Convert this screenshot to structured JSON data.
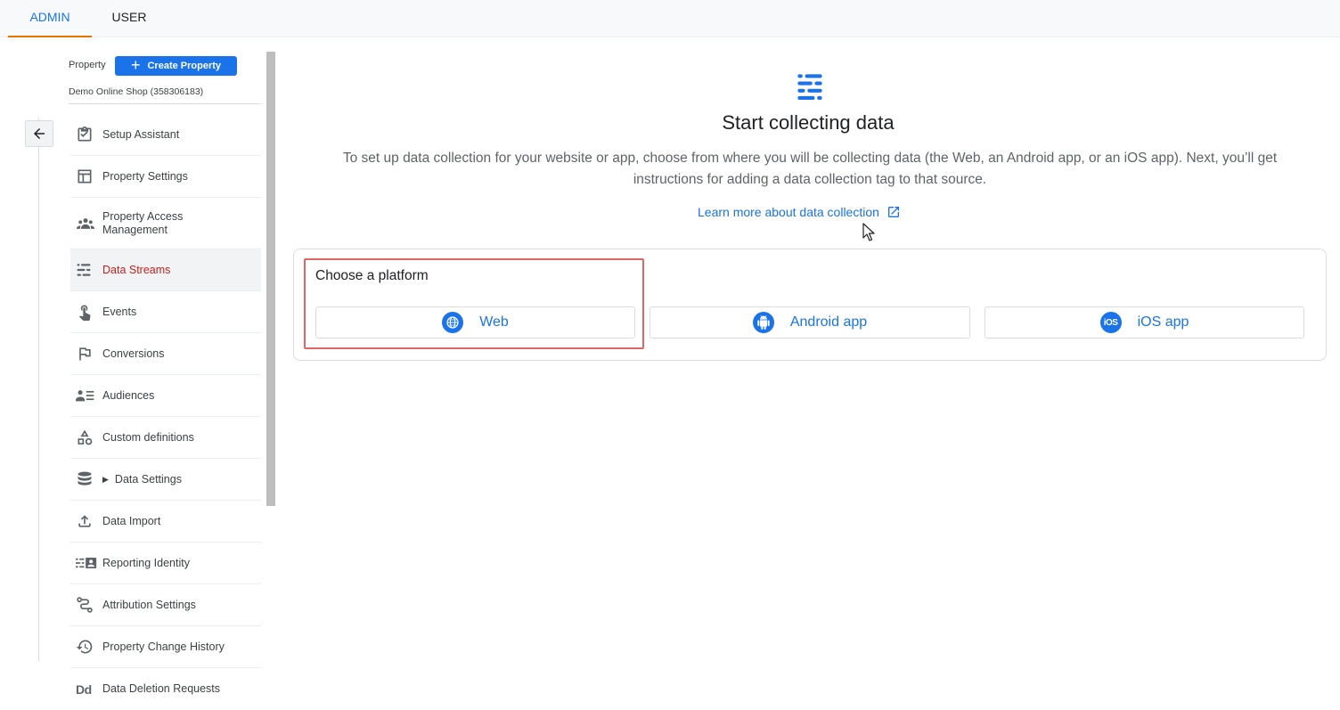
{
  "tabs": [
    {
      "label": "ADMIN",
      "active": true
    },
    {
      "label": "USER",
      "active": false
    }
  ],
  "property": {
    "label": "Property",
    "create_button": "Create Property",
    "name": "Demo Online Shop (358306183)"
  },
  "nav": {
    "items": [
      {
        "label": "Setup Assistant",
        "icon": "clipboard-check-icon"
      },
      {
        "label": "Property Settings",
        "icon": "layout-icon"
      },
      {
        "label": "Property Access Management",
        "icon": "people-icon"
      },
      {
        "label": "Data Streams",
        "icon": "data-streams-icon",
        "active": true
      },
      {
        "label": "Events",
        "icon": "touch-icon"
      },
      {
        "label": "Conversions",
        "icon": "flag-icon"
      },
      {
        "label": "Audiences",
        "icon": "audience-icon"
      },
      {
        "label": "Custom definitions",
        "icon": "shapes-icon"
      },
      {
        "label": "Data Settings",
        "icon": "database-icon",
        "expandable": true
      },
      {
        "label": "Data Import",
        "icon": "upload-icon"
      },
      {
        "label": "Reporting Identity",
        "icon": "reporting-identity-icon"
      },
      {
        "label": "Attribution Settings",
        "icon": "attribution-icon"
      },
      {
        "label": "Property Change History",
        "icon": "history-icon"
      },
      {
        "label": "Data Deletion Requests",
        "icon": "dd-icon"
      }
    ]
  },
  "main": {
    "title": "Start collecting data",
    "description": "To set up data collection for your website or app, choose from where you will be collecting data (the Web, an Android app, or an iOS app). Next, you’ll get instructions for adding a data collection tag to that source.",
    "learn_more": "Learn more about data collection",
    "platform_heading": "Choose a platform",
    "platforms": [
      {
        "label": "Web",
        "icon": "globe-icon"
      },
      {
        "label": "Android app",
        "icon": "android-icon"
      },
      {
        "label": "iOS app",
        "icon": "ios-icon"
      }
    ]
  },
  "colors": {
    "accent": "#1a73e8",
    "active_nav": "#c5221f",
    "tab_underline": "#e37400",
    "highlight": "#e06666"
  }
}
